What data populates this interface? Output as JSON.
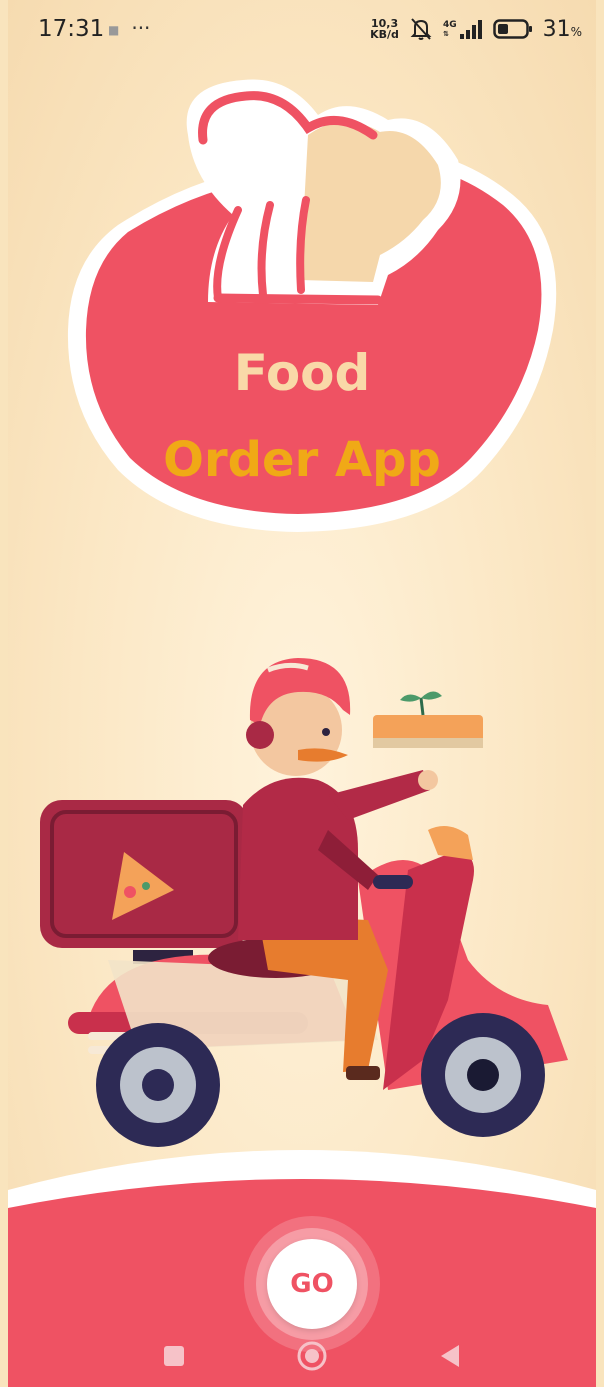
{
  "status_bar": {
    "time": "17:31",
    "overflow": "···",
    "net_speed_value": "10,3",
    "net_speed_unit": "KB/d",
    "network_type": "4G",
    "battery": "31",
    "battery_unit": "%",
    "icons": [
      "notification-dot-icon",
      "mute-bell-icon",
      "signal-icon",
      "battery-icon"
    ]
  },
  "logo": {
    "line1": "Food",
    "line2": "Order App"
  },
  "go_button": {
    "label": "GO"
  },
  "nav_bar": {
    "icons": [
      "recents-icon",
      "home-icon",
      "back-icon"
    ]
  },
  "colors": {
    "background": "#f9e4bd",
    "brand_red": "#ef5263",
    "accent_orange": "#f0a916",
    "logo_cream": "#f9d9a8"
  }
}
